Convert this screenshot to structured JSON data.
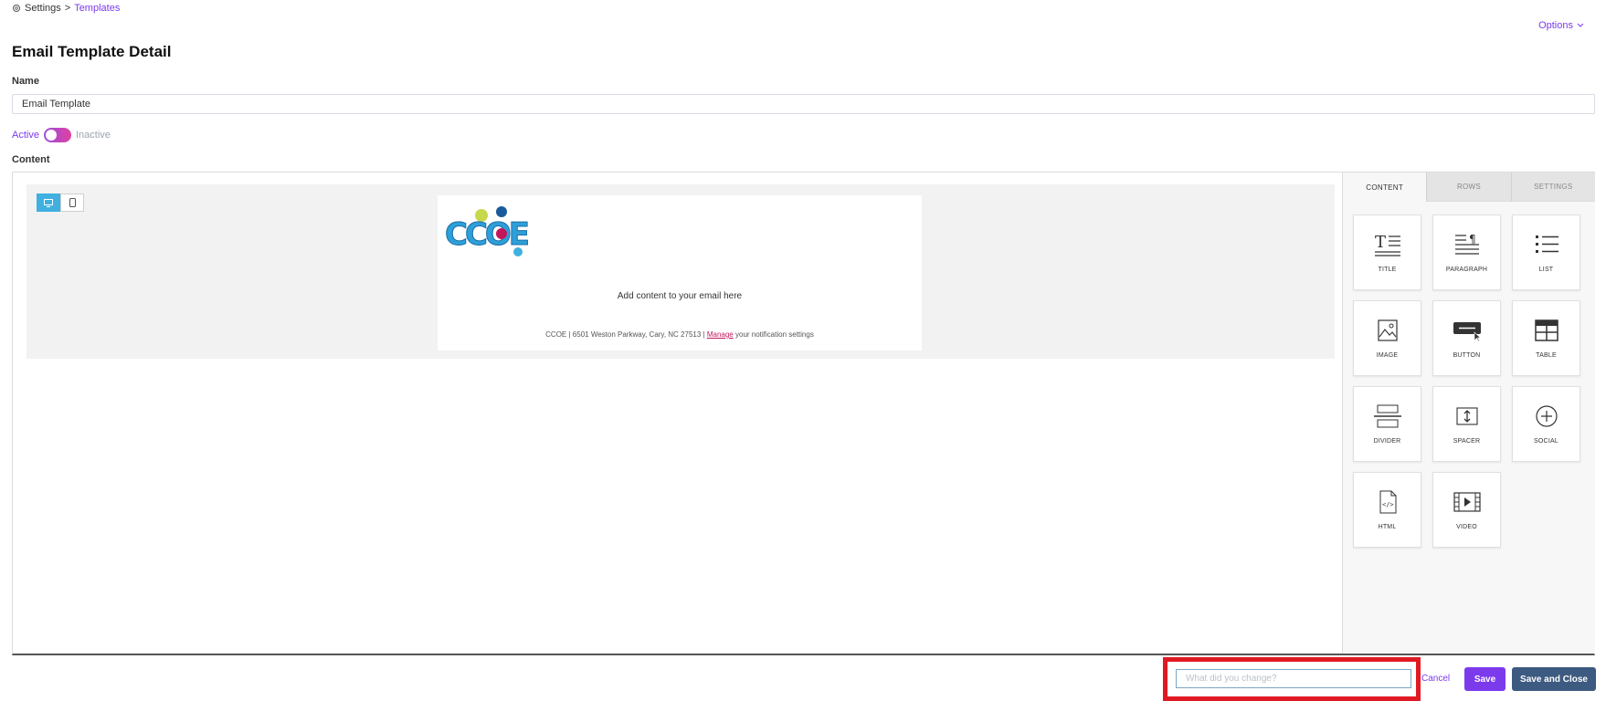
{
  "breadcrumb": {
    "root": "Settings",
    "separator": ">",
    "current": "Templates"
  },
  "options": {
    "label": "Options"
  },
  "page": {
    "title": "Email Template Detail"
  },
  "form": {
    "name_label": "Name",
    "name_value": "Email Template",
    "status": {
      "active_label": "Active",
      "inactive_label": "Inactive",
      "is_active": true
    },
    "content_label": "Content"
  },
  "editor": {
    "device_modes": [
      "desktop",
      "mobile"
    ],
    "active_device": "desktop",
    "email": {
      "logo_text": "CCOE",
      "body_text": "Add content to your email here",
      "footer_prefix": "CCOE | 6501 Weston Parkway, Cary, NC 27513 |",
      "footer_link": "Manage",
      "footer_suffix": "your notification settings"
    },
    "side_tabs": [
      "CONTENT",
      "ROWS",
      "SETTINGS"
    ],
    "active_tab": "CONTENT",
    "blocks": [
      {
        "label": "TITLE",
        "icon": "title-icon"
      },
      {
        "label": "PARAGRAPH",
        "icon": "paragraph-icon"
      },
      {
        "label": "LIST",
        "icon": "list-icon"
      },
      {
        "label": "IMAGE",
        "icon": "image-icon"
      },
      {
        "label": "BUTTON",
        "icon": "button-block-icon"
      },
      {
        "label": "TABLE",
        "icon": "table-icon"
      },
      {
        "label": "DIVIDER",
        "icon": "divider-icon"
      },
      {
        "label": "SPACER",
        "icon": "spacer-icon"
      },
      {
        "label": "SOCIAL",
        "icon": "social-icon"
      },
      {
        "label": "HTML",
        "icon": "html-icon"
      },
      {
        "label": "VIDEO",
        "icon": "video-icon"
      }
    ]
  },
  "footer": {
    "change_placeholder": "What did you change?",
    "cancel_label": "Cancel",
    "save_label": "Save",
    "save_close_label": "Save and Close"
  },
  "colors": {
    "accent": "#7c3aed",
    "highlight": "#e01a22",
    "device_active": "#3fb0e0",
    "save_close": "#3d5a80"
  }
}
